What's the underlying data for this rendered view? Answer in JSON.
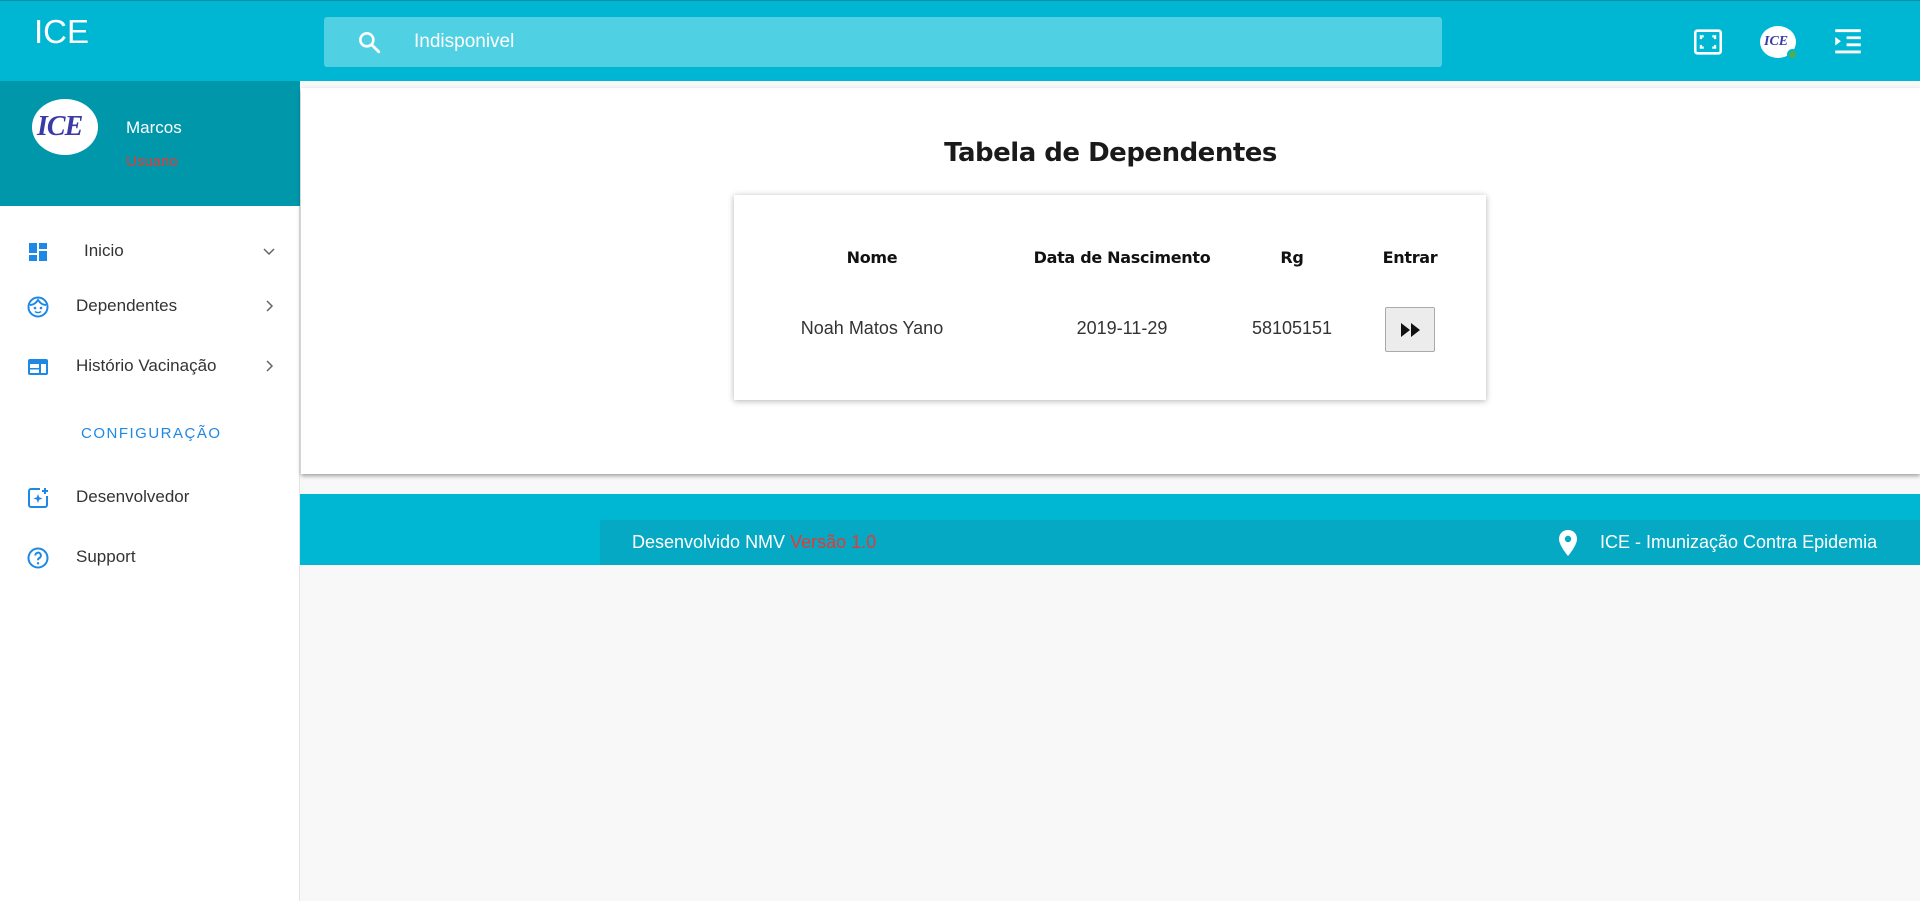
{
  "header": {
    "brand": "ICE",
    "search_value": "Indisponivel",
    "avatar_text": "ICE",
    "icons": [
      "fullscreen-icon",
      "avatar",
      "menu-indent-icon"
    ]
  },
  "sidebar": {
    "profile": {
      "avatar_text": "ICE",
      "name": "Marcos",
      "role": "Usuario"
    },
    "items": [
      {
        "label": "Inicio",
        "icon": "dashboard-icon",
        "chevron": "down"
      },
      {
        "label": "Dependentes",
        "icon": "child-face-icon",
        "chevron": "right"
      },
      {
        "label": "Histório Vacinação",
        "icon": "web-icon",
        "chevron": "right"
      }
    ],
    "section_title": "CONFIGURAÇÃO",
    "config_items": [
      {
        "label": "Desenvolvedor",
        "icon": "add-spark-icon"
      },
      {
        "label": "Support",
        "icon": "help-circle-icon"
      }
    ]
  },
  "main": {
    "title": "Tabela de Dependentes",
    "table": {
      "headers": [
        "Nome",
        "Data de Nascimento",
        "Rg",
        "Entrar"
      ],
      "rows": [
        {
          "nome": "Noah Matos Yano",
          "nascimento": "2019-11-29",
          "rg": "58105151",
          "action_icon": "fast-forward-icon"
        }
      ]
    }
  },
  "footer": {
    "developed": "Desenvolvido NMV",
    "version": "Versão 1.0",
    "app_name": "ICE - Imunização Contra Epidemia"
  },
  "colors": {
    "header_bg": "#00b7d3",
    "profile_bg": "#0097ab",
    "accent_blue": "#1e88e5",
    "role_red": "#e53935"
  }
}
